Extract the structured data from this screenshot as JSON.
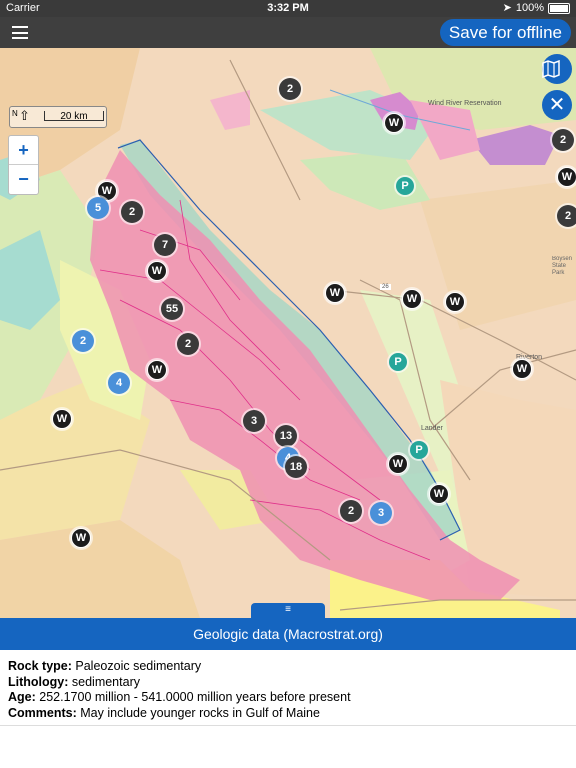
{
  "status_bar": {
    "carrier": "Carrier",
    "time": "3:32 PM",
    "battery": "100%"
  },
  "nav": {
    "save_offline": "Save for offline"
  },
  "map": {
    "scale_label": "20 km",
    "north_label": "N",
    "zoom_in": "+",
    "zoom_out": "−",
    "place_labels": [
      "Wind River Reservation",
      "Riverton",
      "Lander",
      "Boysen State Park"
    ],
    "road_label": "26",
    "markers": [
      {
        "kind": "c",
        "label": "2"
      },
      {
        "kind": "w",
        "label": "W"
      },
      {
        "kind": "w",
        "label": "W"
      },
      {
        "kind": "b",
        "label": "5"
      },
      {
        "kind": "c",
        "label": "2"
      },
      {
        "kind": "c",
        "label": "7"
      },
      {
        "kind": "w",
        "label": "W"
      },
      {
        "kind": "c",
        "label": "55"
      },
      {
        "kind": "b",
        "label": "2"
      },
      {
        "kind": "c",
        "label": "2"
      },
      {
        "kind": "w",
        "label": "W"
      },
      {
        "kind": "b",
        "label": "4"
      },
      {
        "kind": "w",
        "label": "W"
      },
      {
        "kind": "c",
        "label": "3"
      },
      {
        "kind": "c",
        "label": "13"
      },
      {
        "kind": "b",
        "label": "4"
      },
      {
        "kind": "c",
        "label": "18"
      },
      {
        "kind": "c",
        "label": "2"
      },
      {
        "kind": "b",
        "label": "3"
      },
      {
        "kind": "w",
        "label": "W"
      },
      {
        "kind": "w",
        "label": "W"
      },
      {
        "kind": "w",
        "label": "W"
      },
      {
        "kind": "w",
        "label": "W"
      },
      {
        "kind": "w",
        "label": "W"
      },
      {
        "kind": "w",
        "label": "W"
      },
      {
        "kind": "p",
        "label": "P"
      },
      {
        "kind": "p",
        "label": "P"
      },
      {
        "kind": "p",
        "label": "P"
      },
      {
        "kind": "w",
        "label": "W"
      },
      {
        "kind": "c",
        "label": "2"
      },
      {
        "kind": "c",
        "label": "2"
      },
      {
        "kind": "w",
        "label": "W"
      }
    ]
  },
  "panel": {
    "title": "Geologic data (Macrostrat.org)",
    "rock_type_label": "Rock type:",
    "rock_type_value": "Paleozoic sedimentary",
    "lithology_label": "Lithology:",
    "lithology_value": "sedimentary",
    "age_label": "Age:",
    "age_value": "252.1700 million - 541.0000 million years before present",
    "comments_label": "Comments:",
    "comments_value": "May include younger rocks in Gulf of Maine"
  },
  "colors": {
    "accent": "#1565c0",
    "sedimentary": "#ef8fb3",
    "nav_bg": "#3f3f3f"
  }
}
